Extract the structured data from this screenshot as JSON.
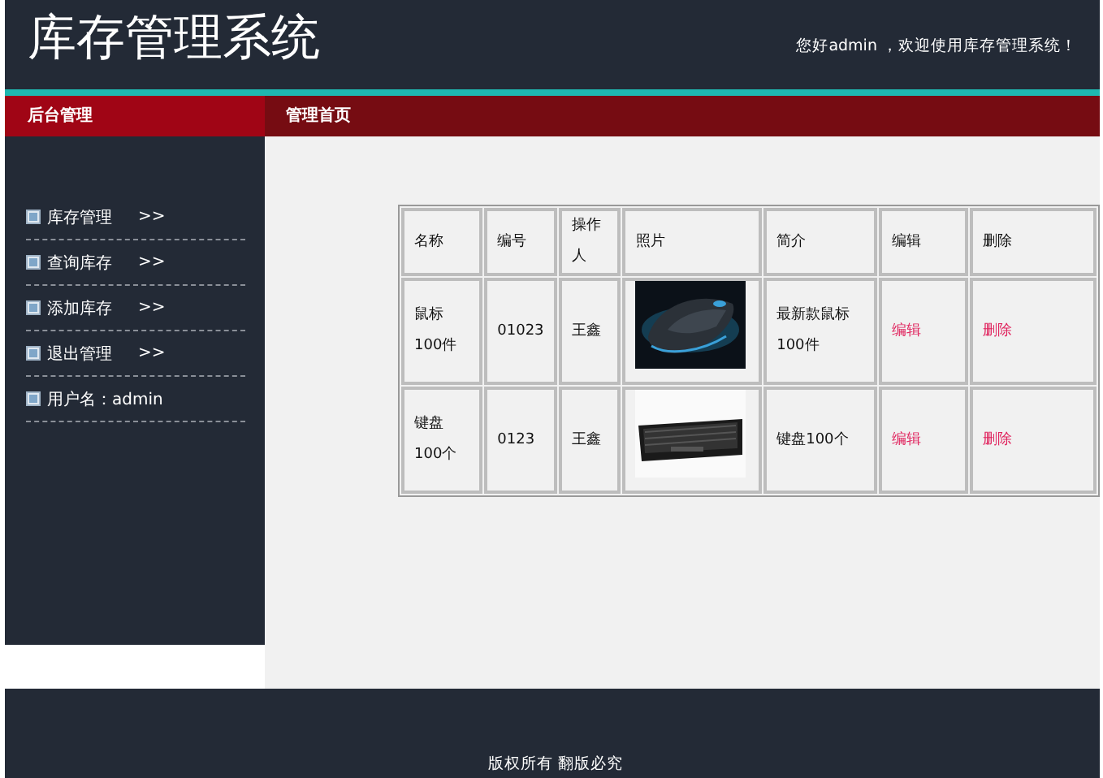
{
  "header": {
    "title": "库存管理系统",
    "greeting": "您好admin ，欢迎使用库存管理系统！"
  },
  "sidebar": {
    "title": "后台管理",
    "items": [
      {
        "label": "库存管理",
        "suffix": ">>"
      },
      {
        "label": "查询库存",
        "suffix": ">>"
      },
      {
        "label": "添加库存",
        "suffix": ">>"
      },
      {
        "label": "退出管理",
        "suffix": ">>"
      },
      {
        "label": "用户名：admin"
      }
    ]
  },
  "main": {
    "title": "管理首页"
  },
  "table": {
    "columns": [
      "名称",
      "编号",
      "操作人",
      "照片",
      "简介",
      "编辑",
      "删除"
    ],
    "rows": [
      {
        "name": "鼠标100件",
        "code": "01023",
        "operator": "王鑫",
        "intro": "最新款鼠标100件",
        "edit": "编辑",
        "delete": "删除"
      },
      {
        "name": "键盘100个",
        "code": "0123",
        "operator": "王鑫",
        "intro": "键盘100个",
        "edit": "编辑",
        "delete": "删除"
      }
    ]
  },
  "footer": {
    "text": "版权所有 翻版必究"
  }
}
